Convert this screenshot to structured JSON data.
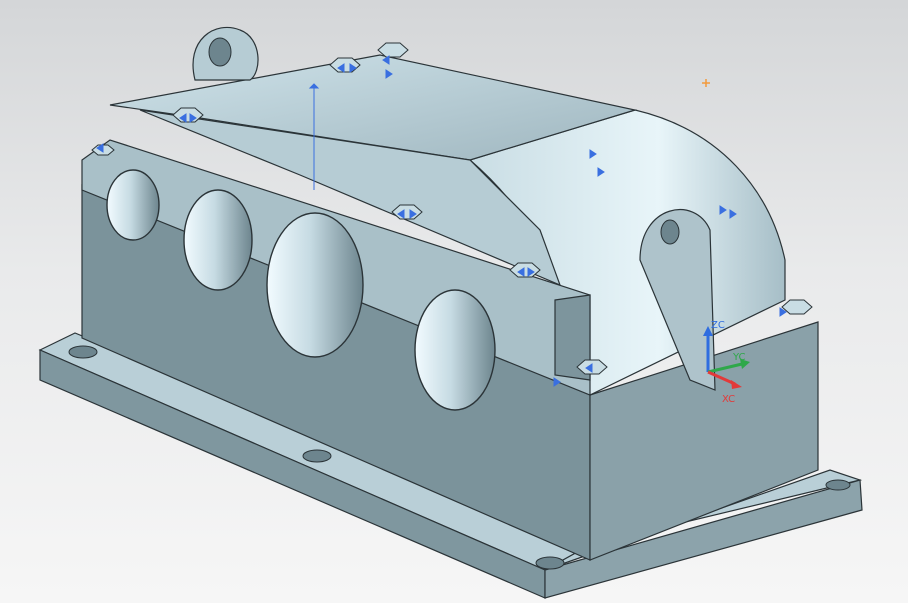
{
  "viewport": {
    "background_top": "#d4d6d8",
    "background_bottom": "#f6f6f6"
  },
  "model": {
    "body_color": "#aec3cb",
    "shade_color": "#8fa5ae",
    "dark_color": "#6f8790",
    "edge_color": "#2b3438",
    "highlight_color": "#dff0f6"
  },
  "triad": {
    "x_label": "XC",
    "y_label": "YC",
    "z_label": "ZC",
    "x_color": "#e23a3a",
    "y_color": "#2fa84a",
    "z_color": "#2f6de0"
  },
  "annotations": {
    "symbol_color": "#3a6fe0",
    "marker_color": "#f39a3b"
  }
}
